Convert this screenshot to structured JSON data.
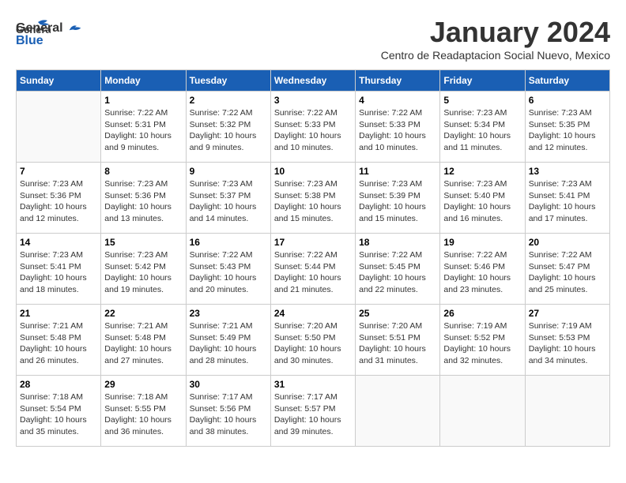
{
  "header": {
    "logo_line1": "General",
    "logo_line2": "Blue",
    "month_title": "January 2024",
    "subtitle": "Centro de Readaptacion Social Nuevo, Mexico"
  },
  "days_of_week": [
    "Sunday",
    "Monday",
    "Tuesday",
    "Wednesday",
    "Thursday",
    "Friday",
    "Saturday"
  ],
  "weeks": [
    [
      {
        "day": "",
        "info": ""
      },
      {
        "day": "1",
        "info": "Sunrise: 7:22 AM\nSunset: 5:31 PM\nDaylight: 10 hours\nand 9 minutes."
      },
      {
        "day": "2",
        "info": "Sunrise: 7:22 AM\nSunset: 5:32 PM\nDaylight: 10 hours\nand 9 minutes."
      },
      {
        "day": "3",
        "info": "Sunrise: 7:22 AM\nSunset: 5:33 PM\nDaylight: 10 hours\nand 10 minutes."
      },
      {
        "day": "4",
        "info": "Sunrise: 7:22 AM\nSunset: 5:33 PM\nDaylight: 10 hours\nand 10 minutes."
      },
      {
        "day": "5",
        "info": "Sunrise: 7:23 AM\nSunset: 5:34 PM\nDaylight: 10 hours\nand 11 minutes."
      },
      {
        "day": "6",
        "info": "Sunrise: 7:23 AM\nSunset: 5:35 PM\nDaylight: 10 hours\nand 12 minutes."
      }
    ],
    [
      {
        "day": "7",
        "info": "Sunrise: 7:23 AM\nSunset: 5:36 PM\nDaylight: 10 hours\nand 12 minutes."
      },
      {
        "day": "8",
        "info": "Sunrise: 7:23 AM\nSunset: 5:36 PM\nDaylight: 10 hours\nand 13 minutes."
      },
      {
        "day": "9",
        "info": "Sunrise: 7:23 AM\nSunset: 5:37 PM\nDaylight: 10 hours\nand 14 minutes."
      },
      {
        "day": "10",
        "info": "Sunrise: 7:23 AM\nSunset: 5:38 PM\nDaylight: 10 hours\nand 15 minutes."
      },
      {
        "day": "11",
        "info": "Sunrise: 7:23 AM\nSunset: 5:39 PM\nDaylight: 10 hours\nand 15 minutes."
      },
      {
        "day": "12",
        "info": "Sunrise: 7:23 AM\nSunset: 5:40 PM\nDaylight: 10 hours\nand 16 minutes."
      },
      {
        "day": "13",
        "info": "Sunrise: 7:23 AM\nSunset: 5:41 PM\nDaylight: 10 hours\nand 17 minutes."
      }
    ],
    [
      {
        "day": "14",
        "info": "Sunrise: 7:23 AM\nSunset: 5:41 PM\nDaylight: 10 hours\nand 18 minutes."
      },
      {
        "day": "15",
        "info": "Sunrise: 7:23 AM\nSunset: 5:42 PM\nDaylight: 10 hours\nand 19 minutes."
      },
      {
        "day": "16",
        "info": "Sunrise: 7:22 AM\nSunset: 5:43 PM\nDaylight: 10 hours\nand 20 minutes."
      },
      {
        "day": "17",
        "info": "Sunrise: 7:22 AM\nSunset: 5:44 PM\nDaylight: 10 hours\nand 21 minutes."
      },
      {
        "day": "18",
        "info": "Sunrise: 7:22 AM\nSunset: 5:45 PM\nDaylight: 10 hours\nand 22 minutes."
      },
      {
        "day": "19",
        "info": "Sunrise: 7:22 AM\nSunset: 5:46 PM\nDaylight: 10 hours\nand 23 minutes."
      },
      {
        "day": "20",
        "info": "Sunrise: 7:22 AM\nSunset: 5:47 PM\nDaylight: 10 hours\nand 25 minutes."
      }
    ],
    [
      {
        "day": "21",
        "info": "Sunrise: 7:21 AM\nSunset: 5:48 PM\nDaylight: 10 hours\nand 26 minutes."
      },
      {
        "day": "22",
        "info": "Sunrise: 7:21 AM\nSunset: 5:48 PM\nDaylight: 10 hours\nand 27 minutes."
      },
      {
        "day": "23",
        "info": "Sunrise: 7:21 AM\nSunset: 5:49 PM\nDaylight: 10 hours\nand 28 minutes."
      },
      {
        "day": "24",
        "info": "Sunrise: 7:20 AM\nSunset: 5:50 PM\nDaylight: 10 hours\nand 30 minutes."
      },
      {
        "day": "25",
        "info": "Sunrise: 7:20 AM\nSunset: 5:51 PM\nDaylight: 10 hours\nand 31 minutes."
      },
      {
        "day": "26",
        "info": "Sunrise: 7:19 AM\nSunset: 5:52 PM\nDaylight: 10 hours\nand 32 minutes."
      },
      {
        "day": "27",
        "info": "Sunrise: 7:19 AM\nSunset: 5:53 PM\nDaylight: 10 hours\nand 34 minutes."
      }
    ],
    [
      {
        "day": "28",
        "info": "Sunrise: 7:18 AM\nSunset: 5:54 PM\nDaylight: 10 hours\nand 35 minutes."
      },
      {
        "day": "29",
        "info": "Sunrise: 7:18 AM\nSunset: 5:55 PM\nDaylight: 10 hours\nand 36 minutes."
      },
      {
        "day": "30",
        "info": "Sunrise: 7:17 AM\nSunset: 5:56 PM\nDaylight: 10 hours\nand 38 minutes."
      },
      {
        "day": "31",
        "info": "Sunrise: 7:17 AM\nSunset: 5:57 PM\nDaylight: 10 hours\nand 39 minutes."
      },
      {
        "day": "",
        "info": ""
      },
      {
        "day": "",
        "info": ""
      },
      {
        "day": "",
        "info": ""
      }
    ]
  ]
}
